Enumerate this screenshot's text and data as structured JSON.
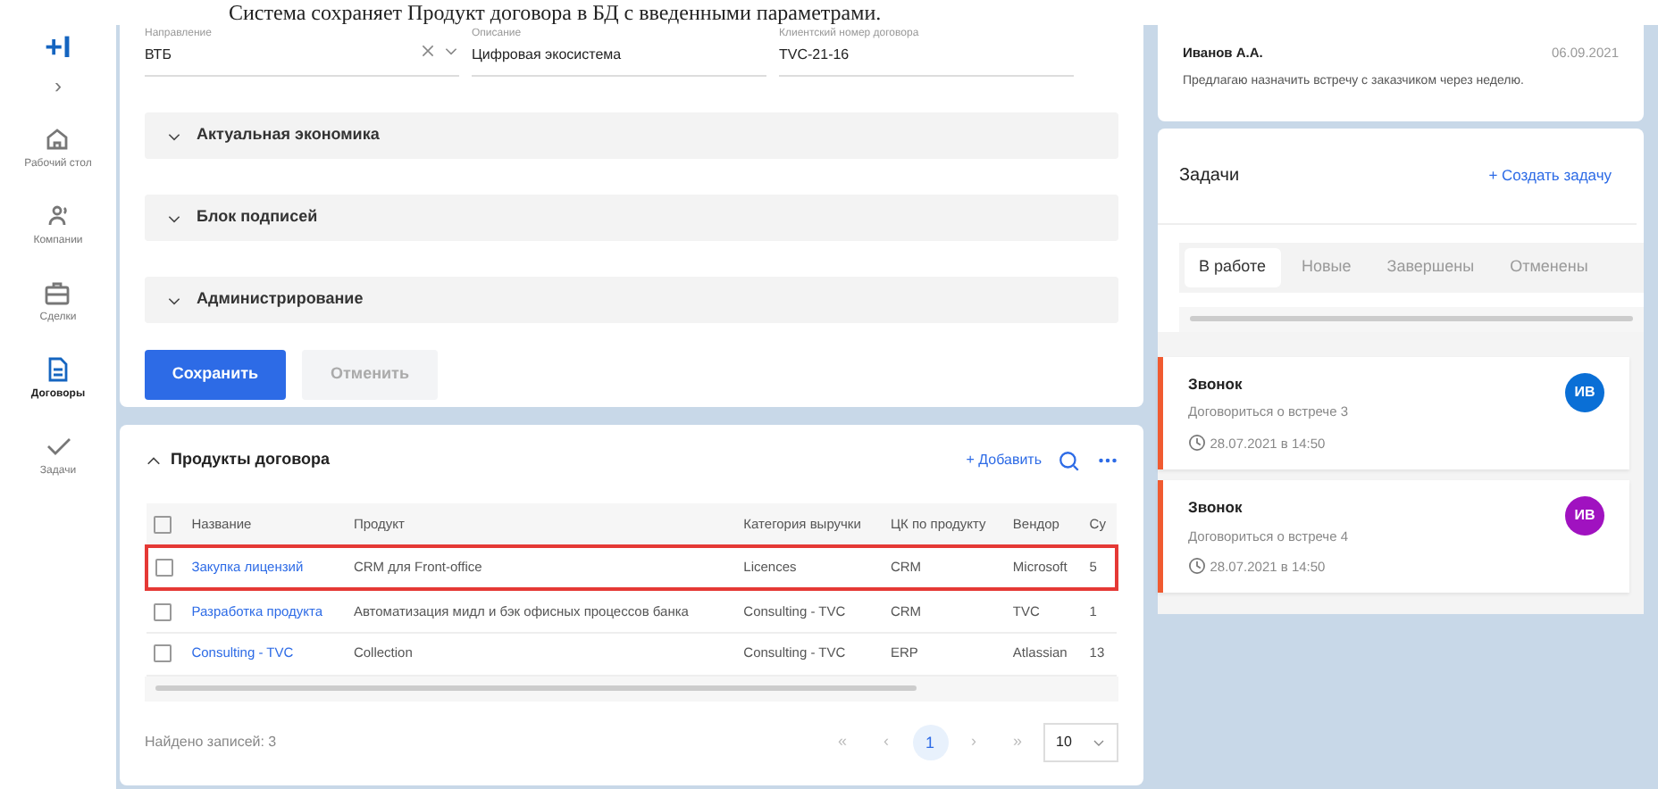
{
  "caption": "Система сохраняет Продукт договора в БД с введенными параметрами.",
  "sidebar": {
    "logo": "+I",
    "expand": "›",
    "items": [
      {
        "label": "Рабочий стол",
        "kind": "home",
        "selected": false
      },
      {
        "label": "Компании",
        "kind": "people",
        "selected": false
      },
      {
        "label": "Сделки",
        "kind": "case",
        "selected": false
      },
      {
        "label": "Договоры",
        "kind": "doc",
        "selected": true
      },
      {
        "label": "Задачи",
        "kind": "check",
        "selected": false
      }
    ]
  },
  "form": {
    "fields": [
      {
        "label": "Направление",
        "value": "ВТБ",
        "kind": "select"
      },
      {
        "label": "Описание",
        "value": "Цифровая экосистема",
        "kind": "text"
      },
      {
        "label": "Клиентский номер договора",
        "value": "TVC-21-16",
        "kind": "text"
      }
    ],
    "sections": [
      {
        "title": "Актуальная экономика",
        "expanded": false
      },
      {
        "title": "Блок подписей",
        "expanded": false
      },
      {
        "title": "Администрирование",
        "expanded": false
      }
    ],
    "save": "Сохранить",
    "cancel": "Отменить"
  },
  "products": {
    "title": "Продукты договора",
    "expanded": true,
    "add": "+ Добавить",
    "select_all_checked": false,
    "columns": [
      "Название",
      "Продукт",
      "Категория выручки",
      "ЦК по продукту",
      "Вендор",
      "Су"
    ],
    "rows": [
      {
        "cells": [
          "Закупка лицензий",
          "CRM для Front-office",
          "Licences",
          "CRM",
          "Microsoft",
          "5"
        ],
        "checked": false,
        "selected": true
      },
      {
        "cells": [
          "Разработка продукта",
          "Автоматизация мидл и бэк офисных процессов банка",
          "Consulting - TVC",
          "CRM",
          "TVC",
          "1"
        ],
        "checked": false,
        "selected": false
      },
      {
        "cells": [
          "Consulting - TVC",
          "Collection",
          "Consulting - TVC",
          "ERP",
          "Atlassian",
          "13"
        ],
        "checked": false,
        "selected": false
      }
    ],
    "found": "Найдено записей: 3",
    "pager": {
      "first": "«",
      "prev": "‹",
      "pages": [
        {
          "label": "1",
          "selected": true
        }
      ],
      "next": "›",
      "last": "»",
      "size": "10"
    }
  },
  "comment": {
    "author": "Иванов А.А.",
    "date": "06.09.2021",
    "text": "Предлагаю назначить встречу с заказчиком через неделю."
  },
  "tasks": {
    "title": "Задачи",
    "create": "+ Создать задачу",
    "tabs": [
      {
        "label": "В работе",
        "selected": true
      },
      {
        "label": "Новые",
        "selected": false
      },
      {
        "label": "Завершены",
        "selected": false
      },
      {
        "label": "Отменены",
        "selected": false
      }
    ],
    "items": [
      {
        "title": "Звонок",
        "text": "Договориться о встрече 3",
        "time": "28.07.2021 в 14:50",
        "avatar": "ИВ",
        "color": "#0a6fd6"
      },
      {
        "title": "Звонок",
        "text": "Договориться о встрече 4",
        "time": "28.07.2021 в 14:50",
        "avatar": "ИВ",
        "color": "#a012c0"
      }
    ]
  }
}
